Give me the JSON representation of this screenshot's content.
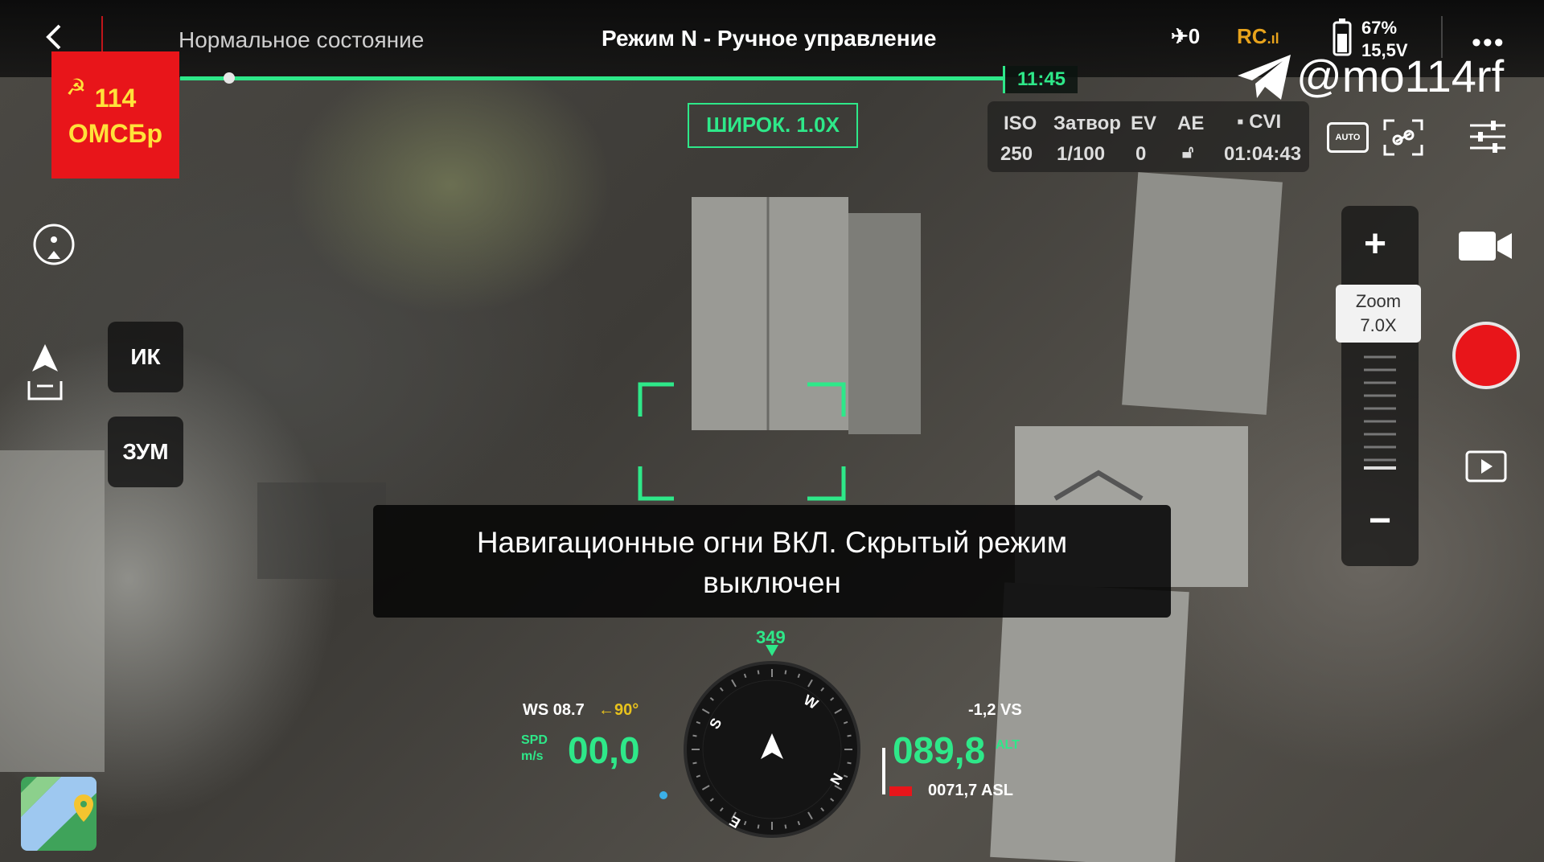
{
  "header": {
    "status": "Нормальное состояние",
    "mode": "Режим N - Ручное управление",
    "signal_count": "0",
    "rc_label": "RC",
    "battery_percent": "67%",
    "battery_voltage": "15,5V"
  },
  "playback": {
    "progress": 0.06,
    "time": "11:45"
  },
  "badge": {
    "line1": "114",
    "line2": "ОМСБр"
  },
  "watermark": {
    "handle": "@mo114rf"
  },
  "camera": {
    "lens_label": "ШИРОК. 1.0X",
    "iso_label": "ISO",
    "iso_value": "250",
    "shutter_label": "Затвор",
    "shutter_value": "1/100",
    "ev_label": "EV",
    "ev_value": "0",
    "ae_label": "AE",
    "storage_label": "CVI",
    "record_time": "01:04:43",
    "auto_label": "AUTO"
  },
  "left_panel": {
    "ir_label": "ИК",
    "zoom_label": "ЗУМ"
  },
  "zoom": {
    "label": "Zoom",
    "value": "7.0X"
  },
  "notification": {
    "line1": "Навигационные огни ВКЛ. Скрытый режим",
    "line2": "выключен"
  },
  "telemetry": {
    "heading": "349",
    "ws_label": "WS 08.7",
    "wind_dir": "90°",
    "spd_unit_top": "SPD",
    "spd_unit_bottom": "m/s",
    "speed": "00,0",
    "vs_label": "-1,2 VS",
    "altitude": "089,8",
    "alt_unit": "ALT",
    "asl": "0071,7 ASL"
  },
  "compass": {
    "north": "N",
    "south": "S",
    "east": "E",
    "west": "W"
  },
  "colors": {
    "accent_green": "#2ee889",
    "record_red": "#e8151a",
    "badge_red": "#e8151a",
    "badge_text": "#ffe23a",
    "rc_orange": "#e8a31c"
  }
}
